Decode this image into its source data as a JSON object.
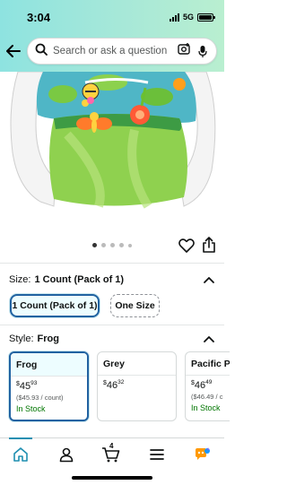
{
  "status_bar": {
    "time": "3:04",
    "network": "5G"
  },
  "search": {
    "placeholder": "Search or ask a question"
  },
  "carousel": {
    "total_images": 5,
    "active_index": 0
  },
  "size": {
    "label": "Size:",
    "selected_value": "1 Count (Pack of 1)",
    "options": [
      "1 Count (Pack of 1)",
      "One Size"
    ]
  },
  "style": {
    "label": "Style:",
    "selected_value": "Frog",
    "cards": [
      {
        "name": "Frog",
        "price_dollars": "45",
        "price_cents": "93",
        "unit_price": "($45.93 / count)",
        "stock": "In Stock"
      },
      {
        "name": "Grey",
        "price_dollars": "46",
        "price_cents": "32",
        "unit_price": "",
        "stock": ""
      },
      {
        "name": "Pacific Pe",
        "price_dollars": "46",
        "price_cents": "49",
        "unit_price": "($46.49 / c",
        "stock": "In Stock"
      }
    ]
  },
  "nav": {
    "cart_count": "4"
  },
  "colors": {
    "accent": "#2162a1",
    "stock_green": "#007600",
    "nav_active": "#1f8fb1"
  }
}
